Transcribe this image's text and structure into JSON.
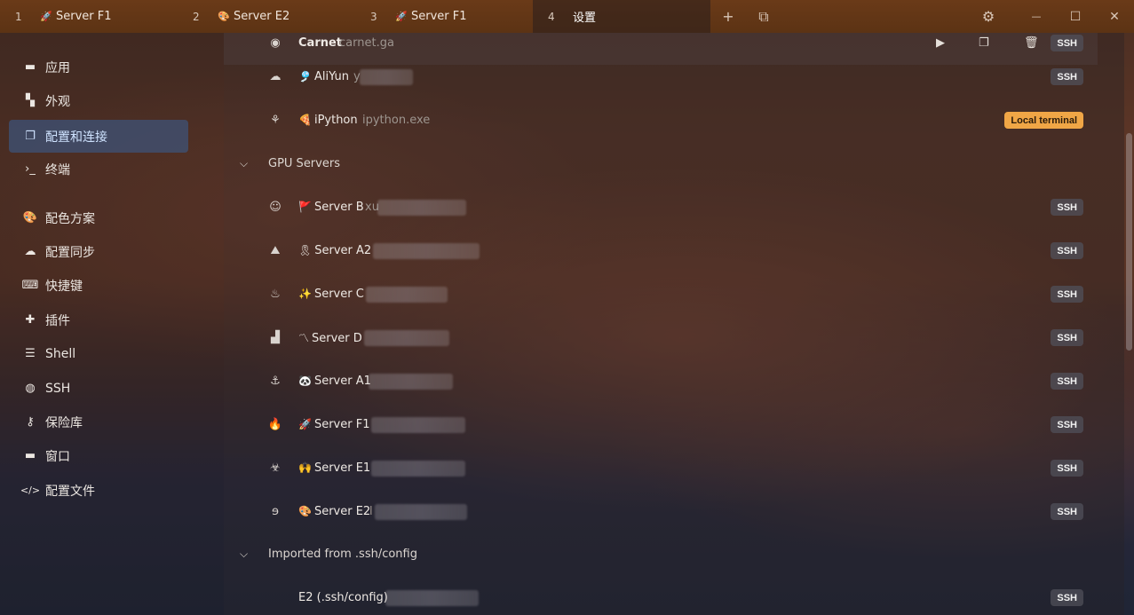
{
  "tabs": [
    {
      "num": "1",
      "emoji": "🚀",
      "label": "Server F1",
      "active": false
    },
    {
      "num": "2",
      "emoji": "🎨",
      "label": "Server E2",
      "active": false
    },
    {
      "num": "3",
      "emoji": "🚀",
      "label": "Server F1",
      "active": false
    },
    {
      "num": "4",
      "emoji": "",
      "label": "设置",
      "active": true
    }
  ],
  "tab_tools": {
    "new_tab": "+",
    "split": "⧉"
  },
  "window": {
    "settings": "⚙",
    "minimize": "—",
    "maximize": "☐",
    "close": "✕"
  },
  "sidebar": {
    "items": [
      {
        "icon": "window-icon",
        "glyph": "▬",
        "label": "应用",
        "active": false
      },
      {
        "icon": "palette-brush-icon",
        "glyph": "▚",
        "label": "外观",
        "active": false
      },
      {
        "icon": "profiles-icon",
        "glyph": "❐",
        "label": "配置和连接",
        "active": true
      },
      {
        "icon": "terminal-icon",
        "glyph": "›_",
        "label": "终端",
        "active": false
      },
      {
        "icon": "palette-icon",
        "glyph": "🎨",
        "label": "配色方案",
        "active": false
      },
      {
        "icon": "cloud-icon",
        "glyph": "☁",
        "label": "配置同步",
        "active": false
      },
      {
        "icon": "keyboard-icon",
        "glyph": "⌨",
        "label": "快捷键",
        "active": false
      },
      {
        "icon": "puzzle-icon",
        "glyph": "✚",
        "label": "插件",
        "active": false
      },
      {
        "icon": "list-icon",
        "glyph": "☰",
        "label": "Shell",
        "active": false
      },
      {
        "icon": "globe-icon",
        "glyph": "◍",
        "label": "SSH",
        "active": false
      },
      {
        "icon": "key-icon",
        "glyph": "⚷",
        "label": "保险库",
        "active": false
      },
      {
        "icon": "window-icon",
        "glyph": "▬",
        "label": "窗口",
        "active": false
      },
      {
        "icon": "code-icon",
        "glyph": "</>",
        "label": "配置文件",
        "active": false
      }
    ]
  },
  "profiles": {
    "top_row": {
      "name": "Carnet",
      "host": "carnet.ga",
      "badge": "SSH"
    },
    "rows_before_group": [
      {
        "icon": "cloud-icon",
        "glyph": "☁",
        "emoji": "🎐",
        "name": "AliYun",
        "host": "y",
        "badge": "SSH",
        "badge_type": "ssh"
      },
      {
        "icon": "python-icon",
        "glyph": "⚘",
        "emoji": "🍕",
        "name": "iPython",
        "host": "ipython.exe",
        "badge": "Local terminal",
        "badge_type": "local"
      }
    ],
    "groups": [
      {
        "label": "GPU Servers",
        "rows": [
          {
            "icon": "masks-icon",
            "glyph": "☺",
            "emoji": "🚩",
            "name": "Server B",
            "host": "xu",
            "badge": "SSH"
          },
          {
            "icon": "mountain-icon",
            "glyph": "⛰",
            "emoji": "🎗",
            "name": "Server A2",
            "host": "",
            "badge": "SSH"
          },
          {
            "icon": "cake-icon",
            "glyph": "♨",
            "emoji": "✨",
            "name": "Server C",
            "host": "",
            "badge": "SSH"
          },
          {
            "icon": "stairs-icon",
            "glyph": "▟",
            "emoji": "〽",
            "name": "Server D",
            "host": "",
            "badge": "SSH"
          },
          {
            "icon": "anchor-icon",
            "glyph": "⚓",
            "emoji": "🐼",
            "name": "Server A1",
            "host": "",
            "badge": "SSH"
          },
          {
            "icon": "fire-icon",
            "glyph": "🔥",
            "emoji": "🚀",
            "name": "Server F1",
            "host": "",
            "badge": "SSH"
          },
          {
            "icon": "biohazard-icon",
            "glyph": "☣",
            "emoji": "🙌",
            "name": "Server E1",
            "host": "",
            "badge": "SSH"
          },
          {
            "icon": "ear-icon",
            "glyph": "ɘ",
            "emoji": "🎨",
            "name": "Server E2",
            "host": "l",
            "badge": "SSH"
          }
        ]
      },
      {
        "label": "Imported from .ssh/config",
        "rows": [
          {
            "icon": "",
            "glyph": "",
            "emoji": "",
            "name": "E2 (.ssh/config)",
            "host": "",
            "badge": "SSH"
          }
        ]
      }
    ]
  }
}
